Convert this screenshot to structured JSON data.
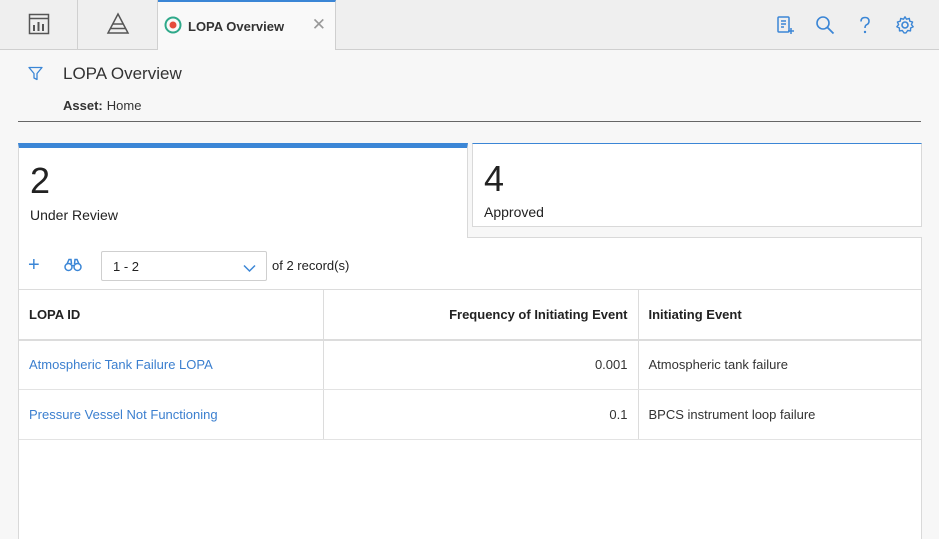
{
  "tabs": {
    "active_label": "LOPA Overview"
  },
  "header": {
    "title": "LOPA Overview",
    "asset_label": "Asset:",
    "asset_value": "Home"
  },
  "cards": [
    {
      "count": "2",
      "label": "Under Review"
    },
    {
      "count": "4",
      "label": "Approved"
    }
  ],
  "toolbar": {
    "page_range": "1 - 2",
    "of_text": "of 2 record(s)"
  },
  "table": {
    "columns": [
      "LOPA ID",
      "Frequency of Initiating Event",
      "Initiating Event"
    ],
    "rows": [
      [
        "Atmospheric Tank Failure LOPA",
        "0.001",
        "Atmospheric tank failure"
      ],
      [
        "Pressure Vessel Not Functioning",
        "0.1",
        "BPCS instrument loop failure"
      ]
    ]
  },
  "colors": {
    "accent": "#3b86d6",
    "link": "#3b7fcf"
  }
}
